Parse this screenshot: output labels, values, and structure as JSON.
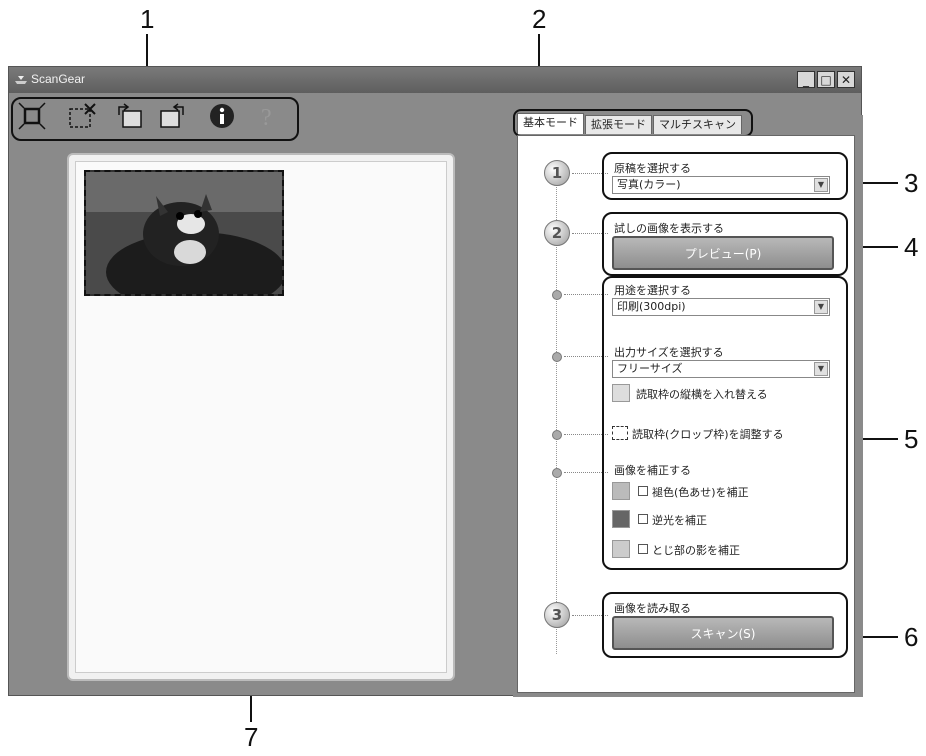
{
  "callouts": [
    "1",
    "2",
    "3",
    "4",
    "5",
    "6",
    "7"
  ],
  "window": {
    "title": "ScanGear"
  },
  "toolbar": {
    "icons": [
      "auto-crop-icon",
      "clear-crop-icon",
      "rotate-left-icon",
      "rotate-right-icon",
      "info-icon",
      "help-icon"
    ]
  },
  "tabs": [
    "基本モード",
    "拡張モード",
    "マルチスキャン"
  ],
  "steps": {
    "step1": {
      "number": "1",
      "label": "原稿を選択する",
      "select_value": "写真(カラー)"
    },
    "step2": {
      "number": "2",
      "label": "試しの画像を表示する",
      "button": "プレビュー(P)"
    },
    "purpose": {
      "label": "用途を選択する",
      "select_value": "印刷(300dpi)"
    },
    "output_size": {
      "label": "出力サイズを選択する",
      "select_value": "フリーサイズ",
      "swap_label": "読取枠の縦横を入れ替える"
    },
    "crop": {
      "label": "読取枠(クロップ枠)を調整する"
    },
    "correction": {
      "label": "画像を補正する",
      "options": [
        "褪色(色あせ)を補正",
        "逆光を補正",
        "とじ部の影を補正"
      ]
    },
    "step3": {
      "number": "3",
      "label": "画像を読み取る",
      "button": "スキャン(S)"
    }
  }
}
